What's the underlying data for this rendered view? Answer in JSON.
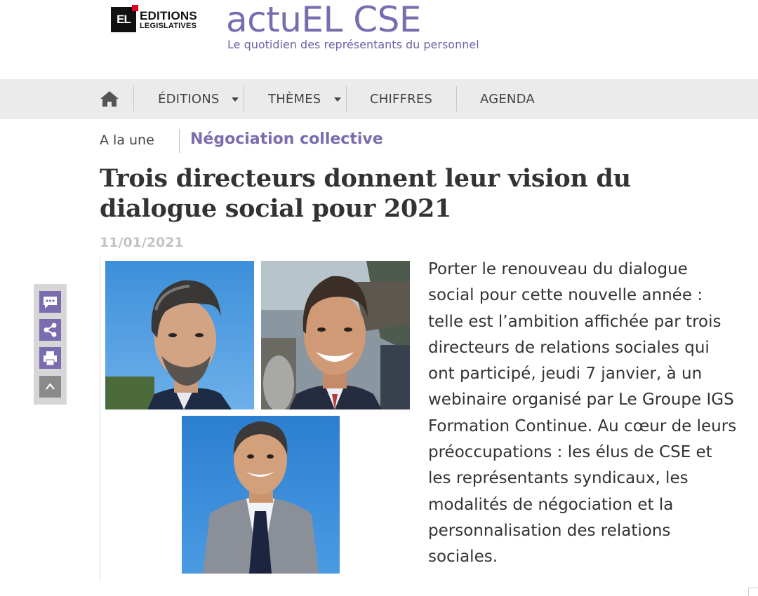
{
  "brand": {
    "logo_mark": "EL",
    "logo_line1": "EDITIONS",
    "logo_line2": "LEGISLATIVES",
    "site_title": "actuEL CSE",
    "tagline": "Le quotidien des représentants du personnel",
    "accent_color": "#7a6cae"
  },
  "nav": {
    "home_icon": "home-icon",
    "items": [
      {
        "label": "ÉDITIONS",
        "has_dropdown": true
      },
      {
        "label": "THÈMES",
        "has_dropdown": true
      },
      {
        "label": "CHIFFRES",
        "has_dropdown": false
      },
      {
        "label": "AGENDA",
        "has_dropdown": false
      }
    ]
  },
  "breadcrumb": {
    "home": "A la une",
    "category": "Négociation collective"
  },
  "article": {
    "title": "Trois directeurs donnent leur vision du dialogue social pour 2021",
    "date": "11/01/2021",
    "lead": "Porter le renouveau du dialogue social pour cette nouvelle année : telle est l’ambition affichée par trois directeurs de relations sociales qui ont participé, jeudi 7 janvier, à un webinaire organisé par Le Groupe IGS Formation Continue. Au cœur de leurs préoccupations : les élus de CSE et les représentants syndicaux, les modalités de négociation et la personnalisation des relations sociales."
  },
  "sharebar": {
    "buttons": [
      "comment-icon",
      "share-icon",
      "print-icon",
      "scroll-top-icon"
    ]
  }
}
